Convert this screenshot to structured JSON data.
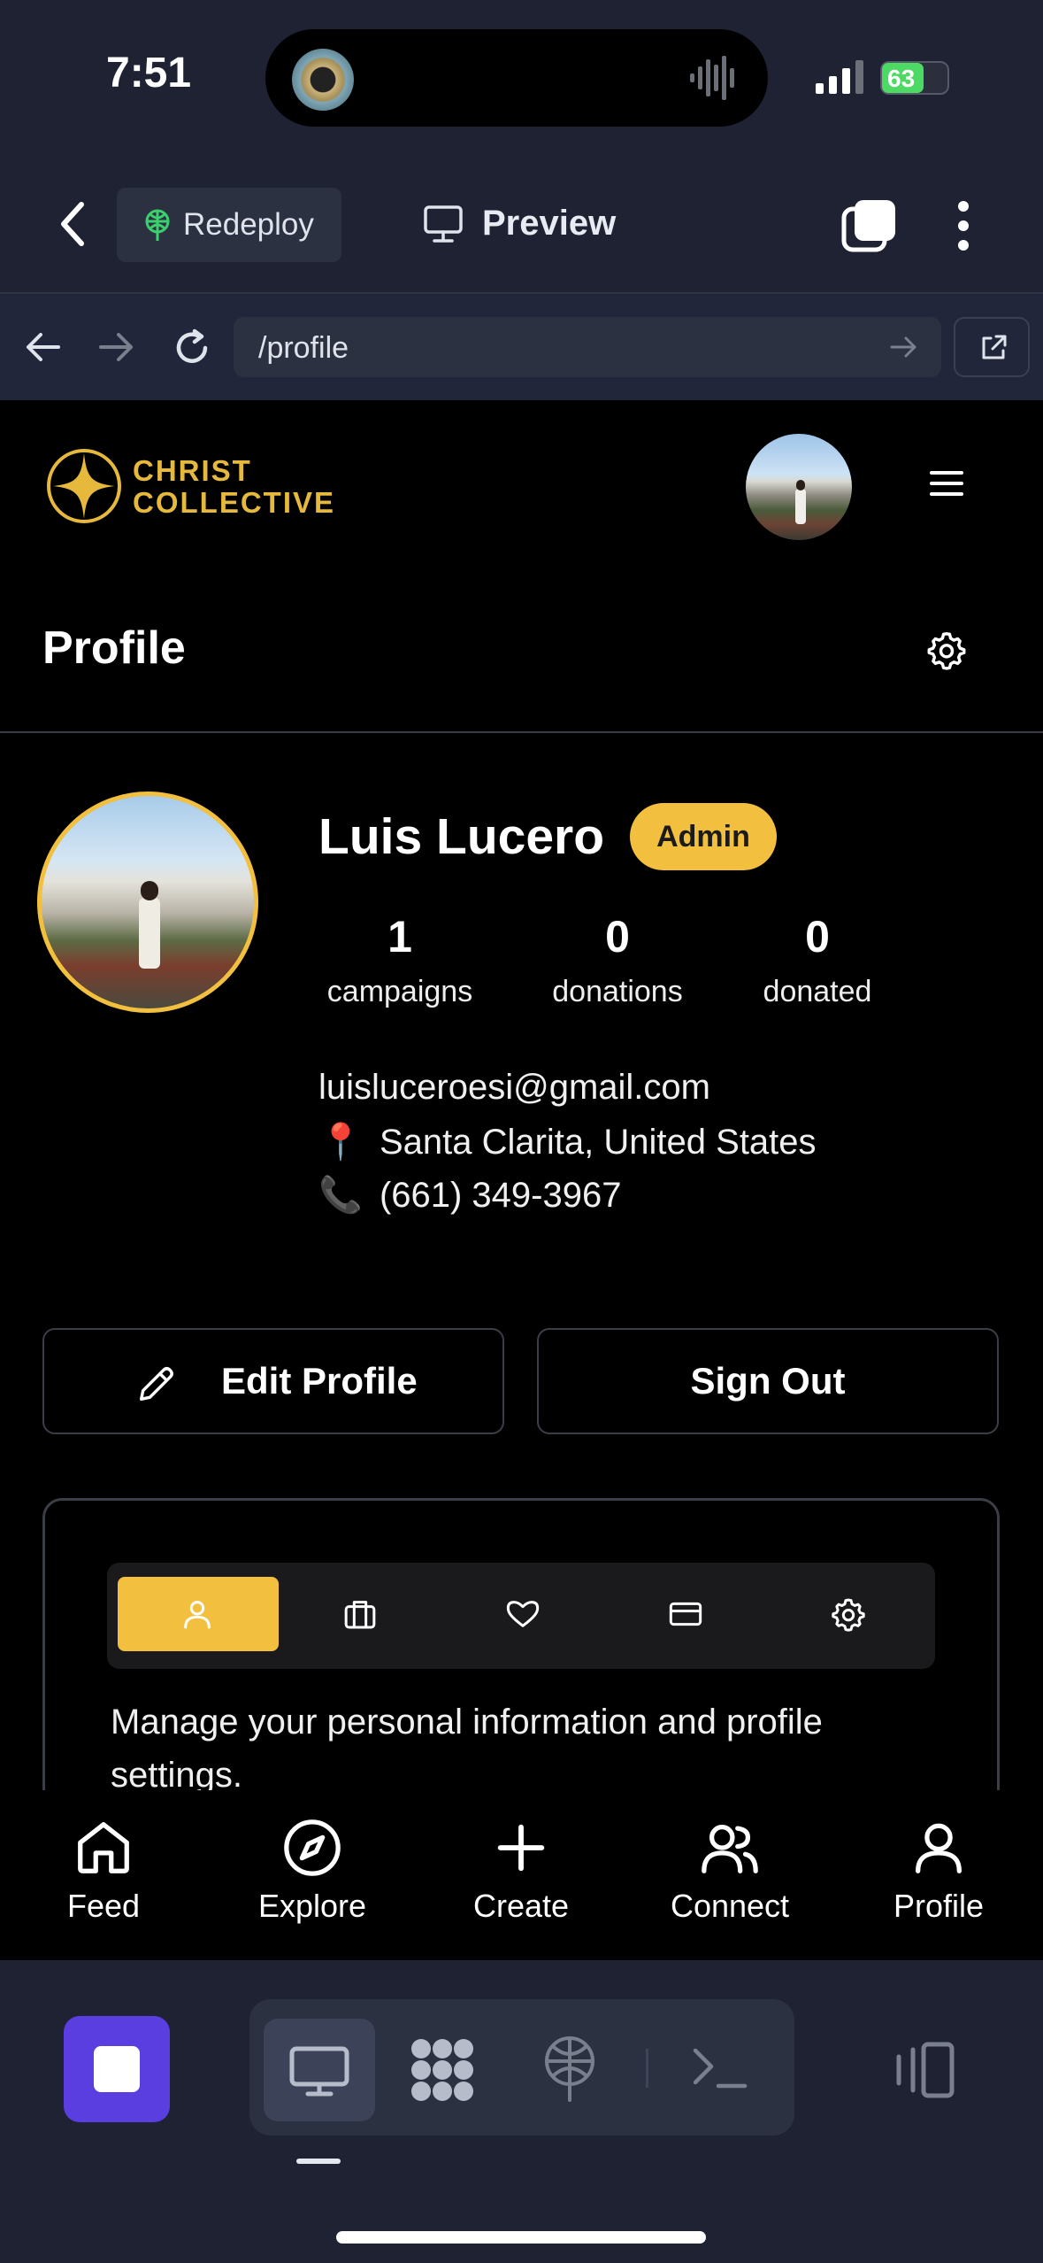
{
  "status_bar": {
    "time": "7:51",
    "battery": "63",
    "battery_level": 0.63
  },
  "toolbar": {
    "redeploy_label": "Redeploy",
    "preview_label": "Preview"
  },
  "browser": {
    "url": "/profile"
  },
  "site": {
    "logo_line1": "CHRIST",
    "logo_line2": "COLLECTIVE",
    "page_title": "Profile"
  },
  "profile": {
    "name": "Luis Lucero",
    "role_badge": "Admin",
    "stats": [
      {
        "value": "1",
        "label": "campaigns"
      },
      {
        "value": "0",
        "label": "donations"
      },
      {
        "value": "0",
        "label": "donated"
      }
    ],
    "email": "luisluceroesi@gmail.com",
    "location": "Santa Clarita, United States",
    "phone": "(661) 349-3967",
    "location_icon": "📍",
    "phone_icon": "📞"
  },
  "actions": {
    "edit_label": "Edit Profile",
    "signout_label": "Sign Out"
  },
  "card": {
    "tabs": [
      "user-icon",
      "briefcase-icon",
      "heart-icon",
      "credit-card-icon",
      "gear-icon"
    ],
    "active_tab": 0,
    "description": "Manage your personal information and profile settings."
  },
  "bottom_nav": [
    {
      "label": "Feed",
      "icon": "home-icon"
    },
    {
      "label": "Explore",
      "icon": "compass-icon"
    },
    {
      "label": "Create",
      "icon": "plus-icon"
    },
    {
      "label": "Connect",
      "icon": "users-icon"
    },
    {
      "label": "Profile",
      "icon": "user-icon"
    }
  ],
  "colors": {
    "accent": "#f2c03e",
    "ide_bg": "#1e2232",
    "stop_button": "#5a3ee0"
  }
}
